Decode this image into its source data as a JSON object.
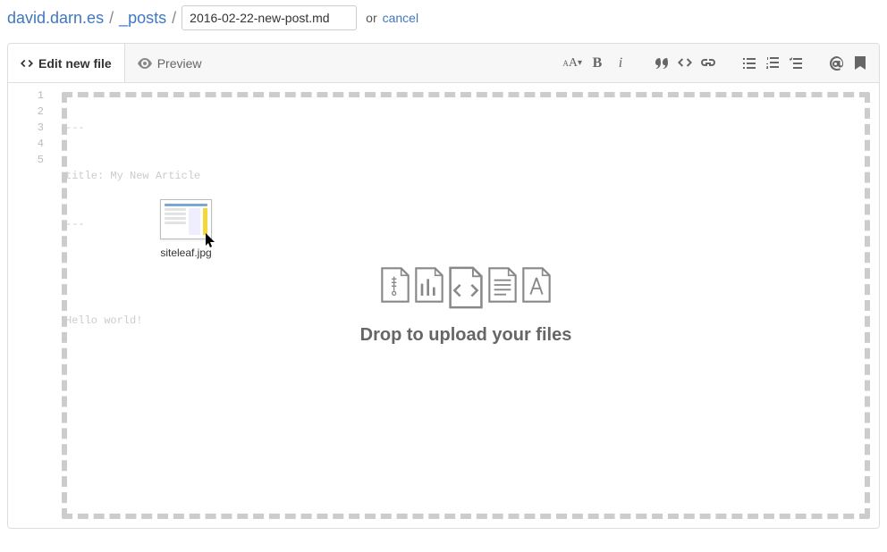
{
  "breadcrumb": {
    "repo": "david.darn.es",
    "folder": "_posts",
    "filename": "2016-02-22-new-post.md",
    "or": "or",
    "cancel": "cancel"
  },
  "tabs": {
    "edit": "Edit new file",
    "preview": "Preview"
  },
  "toolbar": {
    "text_size": "aA",
    "bold": "B",
    "italic": "i"
  },
  "editor": {
    "line_numbers": [
      "1",
      "2",
      "3",
      "4",
      "5"
    ],
    "lines": [
      "---",
      "title: My New Article",
      "---",
      "",
      "Hello world!"
    ]
  },
  "drop": {
    "message": "Drop to upload your files"
  },
  "drag": {
    "filename": "siteleaf.jpg"
  }
}
